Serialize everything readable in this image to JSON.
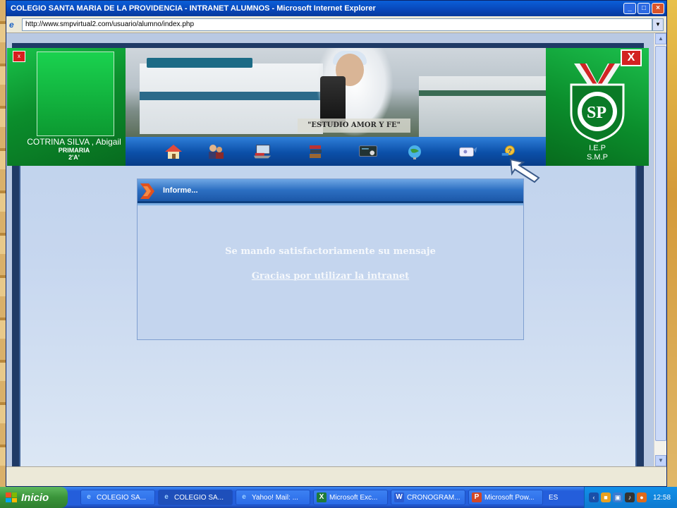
{
  "window": {
    "title": "COLEGIO SANTA MARIA DE LA PROVIDENCIA - INTRANET ALUMNOS - Microsoft Internet Explorer",
    "address_url": "http://www.smpvirtual2.com/usuario/alumno/index.php"
  },
  "header": {
    "student_name": "COTRINA SILVA , Abigail",
    "student_level": "PRIMARIA",
    "student_section": "2'A'",
    "slogan": "\"ESTUDIO AMOR Y FE\"",
    "school_line1": "I.E.P",
    "school_line2": "S.M.P",
    "close_label": "X",
    "nav_icons": [
      "home-icon",
      "users-icon",
      "laptop-icon",
      "books-icon",
      "monitor-icon",
      "globe-icon",
      "mail-icon",
      "key-help-icon"
    ]
  },
  "panel": {
    "title": "Informe...",
    "message": "Se mando satisfactoriamente su mensaje",
    "thanks_link": "Gracias por utilizar la intranet"
  },
  "taskbar": {
    "start_label": "Inicio",
    "tasks": [
      {
        "label": "COLEGIO SA...",
        "icon": "ie-icon"
      },
      {
        "label": "COLEGIO SA...",
        "icon": "ie-icon"
      },
      {
        "label": "Yahoo! Mail: ...",
        "icon": "ie-icon"
      },
      {
        "label": "Microsoft Exc...",
        "icon": "excel-icon"
      },
      {
        "label": "CRONOGRAM...",
        "icon": "word-icon"
      },
      {
        "label": "Microsoft Pow...",
        "icon": "powerpoint-icon"
      }
    ],
    "language": "ES",
    "clock": "12:58"
  },
  "colors": {
    "school_green": "#0b8e2c",
    "nav_blue": "#0b4fa8",
    "panel_bg": "#c4d5ee",
    "taskbar_blue": "#245edb"
  }
}
